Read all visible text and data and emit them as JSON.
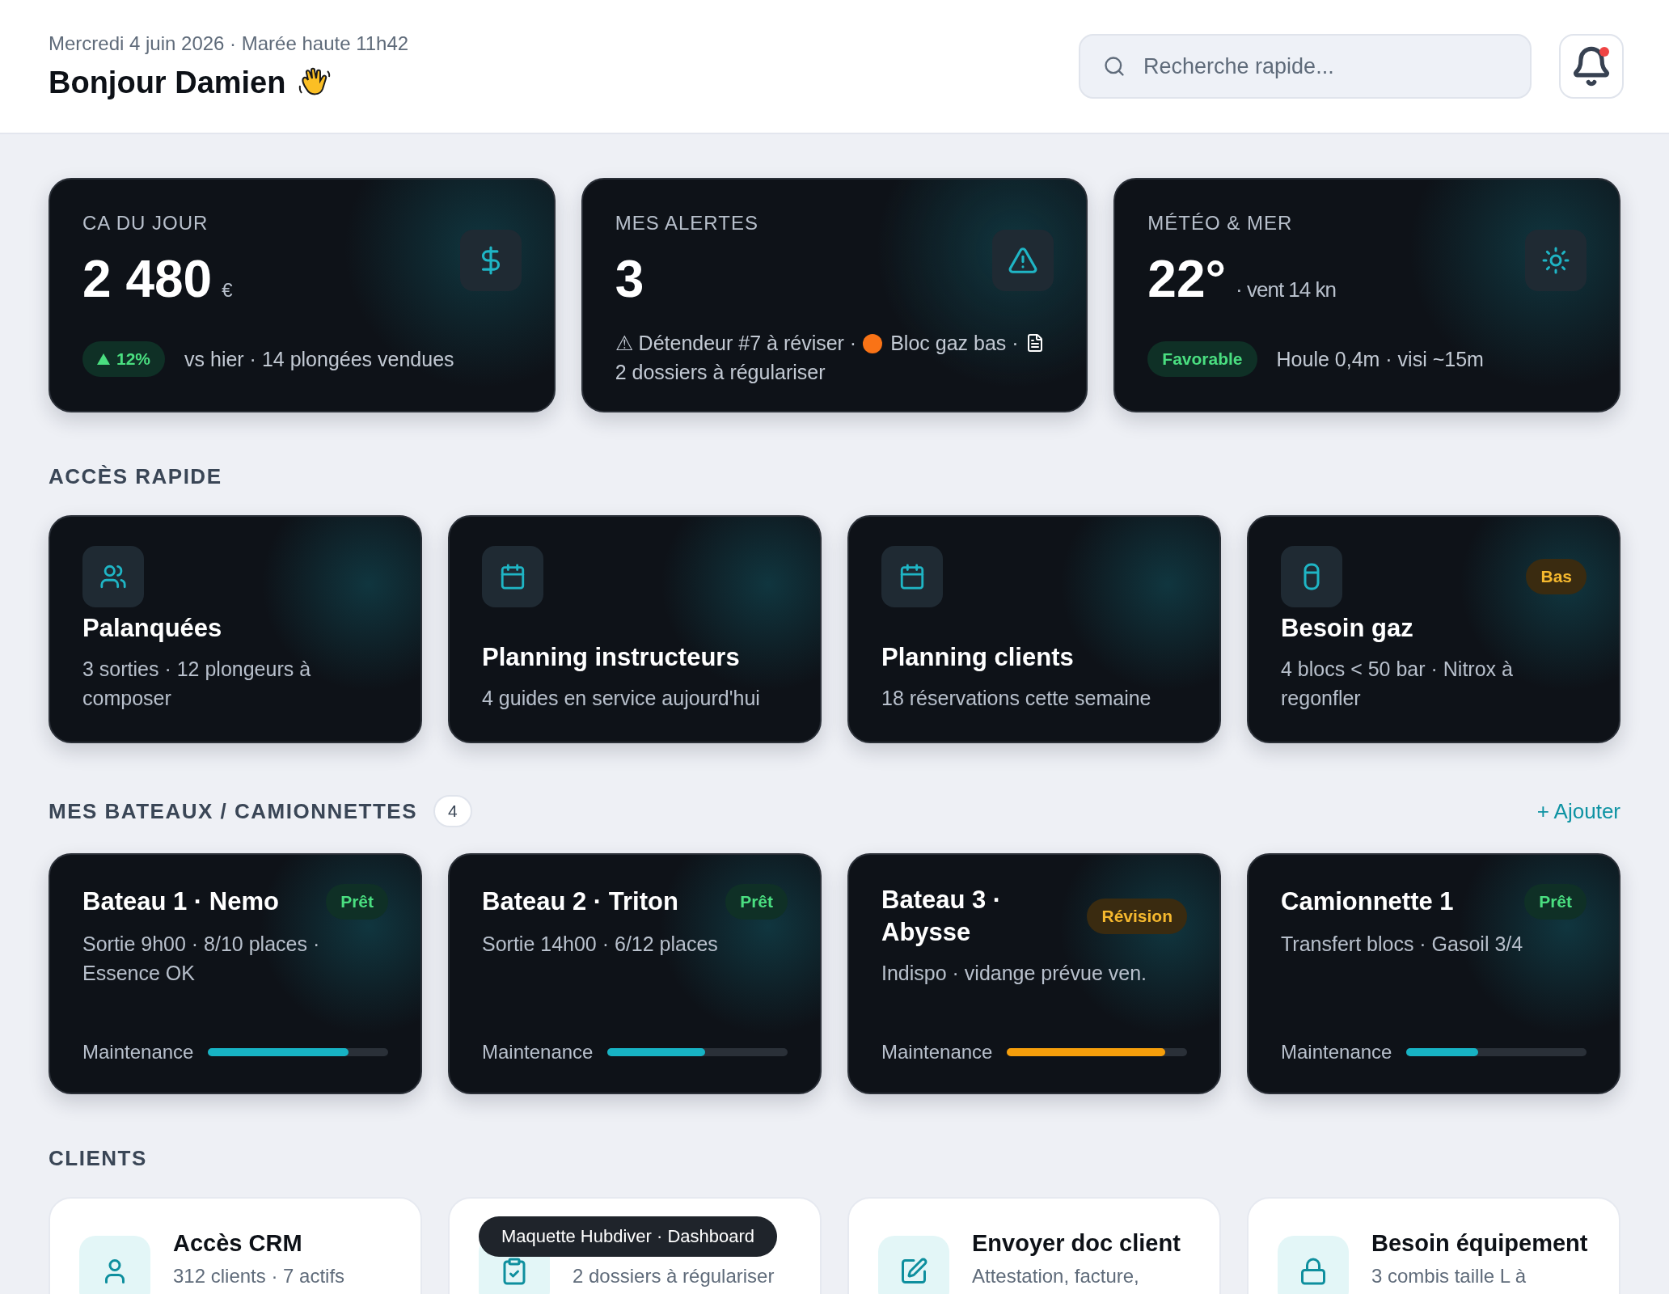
{
  "header": {
    "date_line": "Mercredi 4 juin 2026 · Marée haute 11h42",
    "greeting": "Bonjour Damien",
    "search": {
      "placeholder": "Recherche rapide..."
    },
    "notifications": {
      "unread": true
    }
  },
  "stats": [
    {
      "kind": "revenue",
      "label": "CA DU JOUR",
      "value": "2 480",
      "unit": "€",
      "badge": {
        "text": "12%",
        "kind": "trend_up"
      },
      "note": "vs hier · 14 plongées vendues"
    },
    {
      "kind": "alerts",
      "label": "MES ALERTES",
      "value": "3",
      "alert_items": [
        {
          "kind": "warning",
          "text": "⚠ Détendeur #7 à réviser ·"
        },
        {
          "kind": "dot",
          "color": "#f97316",
          "text": "Bloc gaz bas ·"
        },
        {
          "kind": "document",
          "text": "2 dossiers à régulariser"
        }
      ]
    },
    {
      "kind": "weather",
      "label": "MÉTÉO & MER",
      "value": "22°",
      "unit": "· vent 14 kn",
      "badge": {
        "text": "Favorable",
        "kind": "good"
      },
      "note": "Houle 0,4m · visi ~15m"
    }
  ],
  "quick_access": {
    "title": "ACCÈS RAPIDE",
    "items": [
      {
        "title": "Palanquées",
        "subtitle": "3 sorties · 12 plongeurs à composer"
      },
      {
        "title": "Planning instructeurs",
        "subtitle": "4 guides en service aujourd'hui"
      },
      {
        "title": "Planning clients",
        "subtitle": "18 réservations cette semaine"
      },
      {
        "title": "Besoin gaz",
        "subtitle": "4 blocs < 50 bar · Nitrox à regonfler",
        "badge": "Bas"
      }
    ]
  },
  "vehicles": {
    "title": "MES BATEAUX / CAMIONNETTES",
    "count": "4",
    "add_link": "+ Ajouter",
    "items": [
      {
        "kind": "ready",
        "name": "Bateau 1 · Nemo",
        "status": "Prêt",
        "description": "Sortie 9h00 · 8/10 places · Essence OK",
        "maintenance_label": "Maintenance",
        "level": 0.78
      },
      {
        "kind": "ready",
        "name": "Bateau 2 · Triton",
        "status": "Prêt",
        "description": "Sortie 14h00 · 6/12 places",
        "maintenance_label": "Maintenance",
        "level": 0.54
      },
      {
        "kind": "revision",
        "name": "Bateau 3 · Abysse",
        "status": "Révision",
        "description": "Indispo · vidange prévue ven.",
        "maintenance_label": "Maintenance",
        "level": 0.88
      },
      {
        "kind": "ready",
        "name": "Camionnette 1",
        "status": "Prêt",
        "description": "Transfert blocs · Gasoil 3/4",
        "maintenance_label": "Maintenance",
        "level": 0.4
      }
    ]
  },
  "clients": {
    "title": "CLIENTS",
    "items": [
      {
        "title": "Accès CRM",
        "subtitle": "312 clients · 7 actifs"
      },
      {
        "subtitle": "2 dossiers à régulariser"
      },
      {
        "title": "Envoyer doc client",
        "subtitle": "Attestation, facture,"
      },
      {
        "title": "Besoin équipement",
        "subtitle": "3 combis taille L à"
      }
    ]
  },
  "tooltip": "Maquette Hubdiver · Dashboard"
}
